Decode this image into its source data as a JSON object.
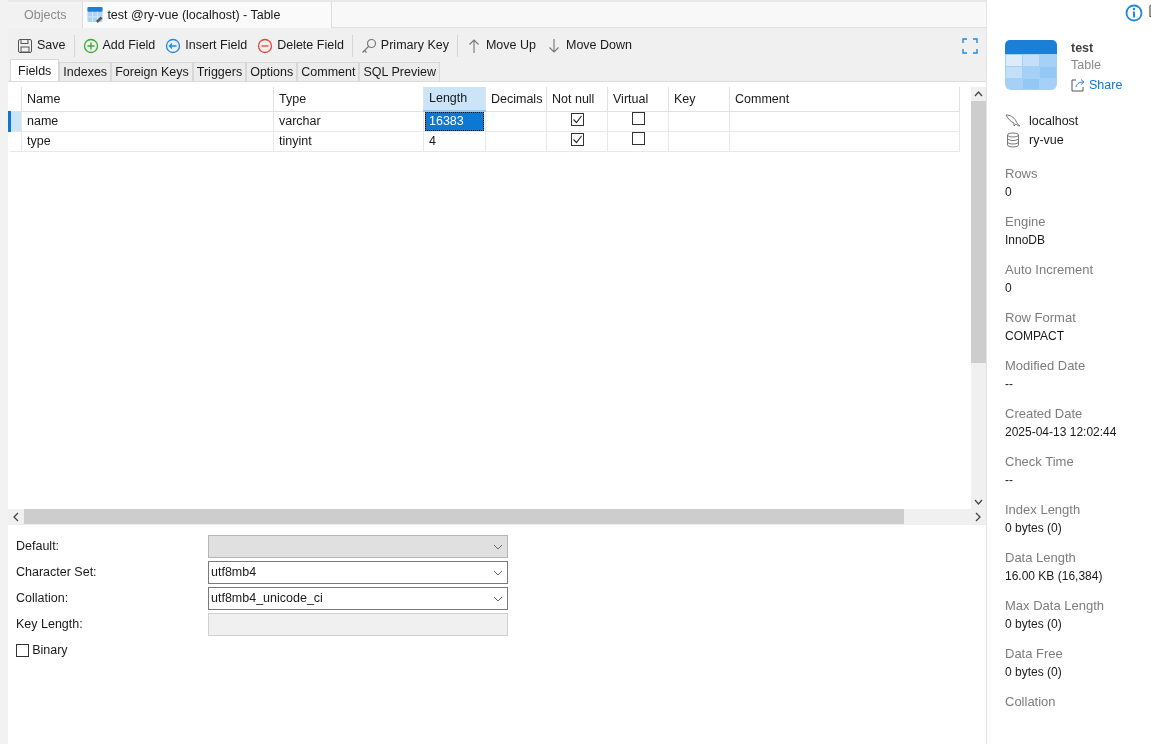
{
  "window_tabs": [
    {
      "label": "Objects",
      "selected": false
    },
    {
      "label": "test @ry-vue (localhost) - Table",
      "selected": true
    }
  ],
  "toolbar": [
    {
      "label": "Save",
      "kind": "save"
    },
    {
      "label": "Add Field",
      "kind": "add"
    },
    {
      "label": "Insert Field",
      "kind": "insert"
    },
    {
      "label": "Delete Field",
      "kind": "delete"
    },
    {
      "label": "Primary Key",
      "kind": "key"
    },
    {
      "label": "Move Up",
      "kind": "up"
    },
    {
      "label": "Move Down",
      "kind": "down"
    }
  ],
  "sub_tabs": [
    {
      "label": "Fields",
      "selected": true
    },
    {
      "label": "Indexes",
      "selected": false
    },
    {
      "label": "Foreign Keys",
      "selected": false
    },
    {
      "label": "Triggers",
      "selected": false
    },
    {
      "label": "Options",
      "selected": false
    },
    {
      "label": "Comment",
      "selected": false
    },
    {
      "label": "SQL Preview",
      "selected": false
    }
  ],
  "table": {
    "columns": [
      {
        "label": "Name",
        "selected": false
      },
      {
        "label": "Type",
        "selected": false
      },
      {
        "label": "Length",
        "selected": true
      },
      {
        "label": "Decimals",
        "selected": false
      },
      {
        "label": "Not null",
        "selected": false
      },
      {
        "label": "Virtual",
        "selected": false
      },
      {
        "label": "Key",
        "selected": false
      },
      {
        "label": "Comment",
        "selected": false
      }
    ],
    "rows": [
      {
        "selected": true,
        "name": "name",
        "type": "varchar",
        "length": "16383",
        "not_null": true,
        "virtual": false
      },
      {
        "selected": false,
        "name": "type",
        "type": "tinyint",
        "length": "4",
        "not_null": true,
        "virtual": false
      }
    ]
  },
  "field_options": [
    {
      "label": "Default:",
      "kind": "select",
      "disabled": true
    },
    {
      "label": "Character Set:",
      "kind": "select",
      "disabled": false,
      "value": "utf8mb4"
    },
    {
      "label": "Collation:",
      "kind": "select",
      "disabled": false,
      "value": "utf8mb4_unicode_ci"
    },
    {
      "label": "Key Length:",
      "kind": "text",
      "disabled": true
    },
    {
      "label": "Binary",
      "kind": "checkbox",
      "checked": false
    }
  ],
  "info_panel": {
    "title": "test",
    "subtitle": "Table",
    "share": "Share",
    "connection": "localhost",
    "database": "ry-vue",
    "properties": [
      {
        "label": "Rows",
        "value": "0"
      },
      {
        "label": "Engine",
        "value": "InnoDB"
      },
      {
        "label": "Auto Increment",
        "value": "0"
      },
      {
        "label": "Row Format",
        "value": "COMPACT"
      },
      {
        "label": "Modified Date",
        "value": "--"
      },
      {
        "label": "Created Date",
        "value": "2025-04-13 12:02:44"
      },
      {
        "label": "Check Time",
        "value": "--"
      },
      {
        "label": "Index Length",
        "value": "0 bytes (0)"
      },
      {
        "label": "Data Length",
        "value": "16.00 KB (16,384)"
      },
      {
        "label": "Max Data Length",
        "value": "0 bytes (0)"
      },
      {
        "label": "Data Free",
        "value": "0 bytes (0)"
      },
      {
        "label": "Collation"
      }
    ]
  }
}
